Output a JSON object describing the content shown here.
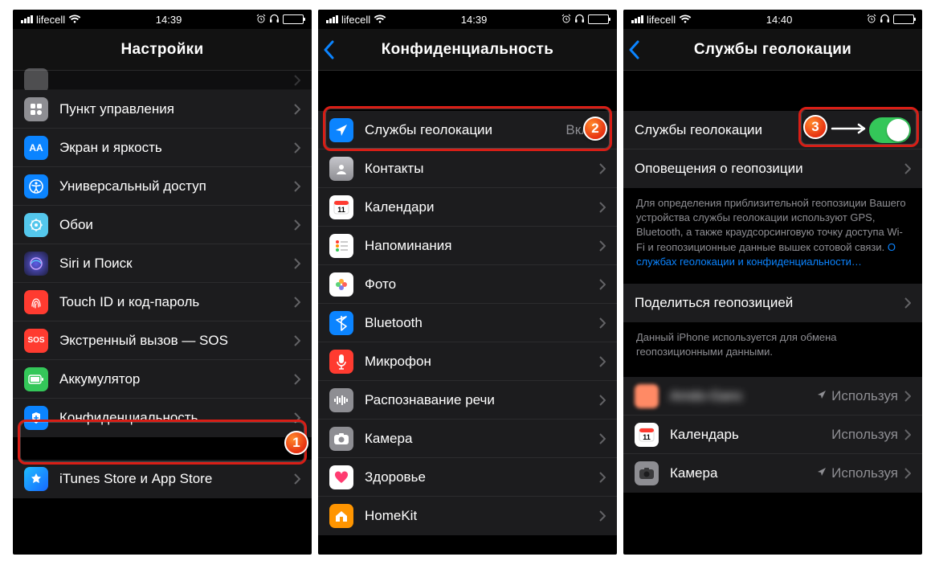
{
  "status": {
    "carrier": "lifecell",
    "time_a": "14:39",
    "time_b": "14:39",
    "time_c": "14:40"
  },
  "screen1": {
    "title": "Настройки",
    "rows": {
      "control_center": "Пункт управления",
      "display": "Экран и яркость",
      "accessibility": "Универсальный доступ",
      "wallpaper": "Обои",
      "siri": "Siri и Поиск",
      "touchid": "Touch ID и код-пароль",
      "sos": "Экстренный вызов — SOS",
      "battery": "Аккумулятор",
      "privacy": "Конфиденциальность",
      "itunes": "iTunes Store и App Store"
    }
  },
  "screen2": {
    "title": "Конфиденциальность",
    "rows": {
      "location": "Службы геолокации",
      "location_detail": "Вкл.",
      "contacts": "Контакты",
      "calendars": "Календари",
      "reminders": "Напоминания",
      "photos": "Фото",
      "bluetooth": "Bluetooth",
      "microphone": "Микрофон",
      "speech": "Распознавание речи",
      "camera": "Камера",
      "health": "Здоровье",
      "homekit": "HomeKit"
    }
  },
  "screen3": {
    "title": "Службы геолокации",
    "rows": {
      "location_services": "Службы геолокации",
      "alerts": "Оповещения о геопозиции",
      "share": "Поделиться геопозицией",
      "app1": "Amdo-Ganc",
      "calendar": "Календарь",
      "camera": "Камера",
      "using": "Используя"
    },
    "footer1_a": "Для определения приблизительной геопозиции Вашего устройства службы геолокации используют GPS, Bluetooth, а также краудсорсинговую точку доступа Wi-Fi и геопозиционные данные вышек сотовой связи. ",
    "footer1_link": "О службах геолокации и конфиденциальности…",
    "footer2": "Данный iPhone используется для обмена геопозиционными данными."
  }
}
